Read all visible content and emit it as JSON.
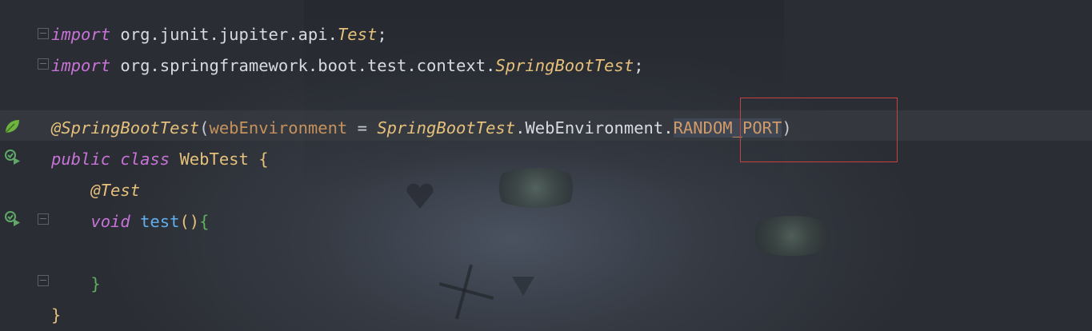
{
  "editor": {
    "lines": [
      {
        "tokens": [
          {
            "t": "import",
            "c": "kw"
          },
          {
            "t": " org.junit.jupiter.api.",
            "c": "pkg"
          },
          {
            "t": "Test",
            "c": "cls-it"
          },
          {
            "t": ";",
            "c": "pkg"
          }
        ]
      },
      {
        "tokens": [
          {
            "t": "import",
            "c": "kw"
          },
          {
            "t": " org.springframework.boot.test.context.",
            "c": "pkg"
          },
          {
            "t": "SpringBootTest",
            "c": "cls-it"
          },
          {
            "t": ";",
            "c": "pkg"
          }
        ]
      },
      {
        "tokens": []
      },
      {
        "tokens": [
          {
            "t": "@SpringBootTest",
            "c": "ann"
          },
          {
            "t": "(",
            "c": "paren"
          },
          {
            "t": "webEnvironment",
            "c": "param"
          },
          {
            "t": " = ",
            "c": "op"
          },
          {
            "t": "SpringBootTest",
            "c": "cls-it"
          },
          {
            "t": ".WebEnvironment.",
            "c": "pkg"
          },
          {
            "t": "RANDOM_PORT",
            "c": "field hl"
          },
          {
            "t": ")",
            "c": "paren"
          }
        ]
      },
      {
        "tokens": [
          {
            "t": "public",
            "c": "kw"
          },
          {
            "t": " ",
            "c": "op"
          },
          {
            "t": "class",
            "c": "kw"
          },
          {
            "t": " WebTest ",
            "c": "cls"
          },
          {
            "t": "{",
            "c": "brace-y"
          }
        ]
      },
      {
        "tokens": [
          {
            "t": "    ",
            "c": "op"
          },
          {
            "t": "@Test",
            "c": "ann"
          }
        ]
      },
      {
        "tokens": [
          {
            "t": "    ",
            "c": "op"
          },
          {
            "t": "void",
            "c": "kw"
          },
          {
            "t": " ",
            "c": "op"
          },
          {
            "t": "test",
            "c": "method"
          },
          {
            "t": "()",
            "c": "paren-y"
          },
          {
            "t": "{",
            "c": "brace-g"
          }
        ]
      },
      {
        "tokens": []
      },
      {
        "tokens": [
          {
            "t": "    ",
            "c": "op"
          },
          {
            "t": "}",
            "c": "brace-g"
          }
        ]
      },
      {
        "tokens": [
          {
            "t": "}",
            "c": "brace-y"
          }
        ]
      }
    ]
  },
  "gutter": {
    "icons": [
      {
        "name": "fold-marker-icon",
        "line": 1
      },
      {
        "name": "fold-marker-icon",
        "line": 2
      },
      {
        "name": "spring-bean-icon",
        "line": 4
      },
      {
        "name": "run-test-class-icon",
        "line": 5
      },
      {
        "name": "run-test-method-icon",
        "line": 7
      },
      {
        "name": "fold-marker-icon",
        "line": 7
      },
      {
        "name": "fold-marker-icon",
        "line": 9
      }
    ]
  },
  "colors": {
    "keyword": "#c773d7",
    "annotation": "#e5c07b",
    "parameter": "#c5915c",
    "method": "#61afef",
    "brace_green": "#5faf5f",
    "highlight_box": "#c8403f",
    "spring_icon": "#6db33f"
  }
}
